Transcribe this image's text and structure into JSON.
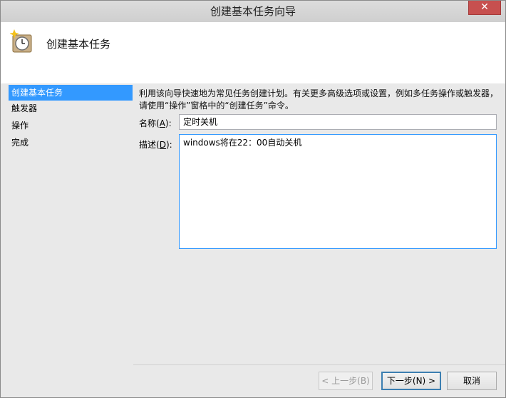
{
  "window": {
    "title": "创建基本任务向导",
    "close_label": "✕"
  },
  "header": {
    "title": "创建基本任务"
  },
  "sidebar": {
    "items": [
      {
        "label": "创建基本任务",
        "active": true
      },
      {
        "label": "触发器",
        "active": false
      },
      {
        "label": "操作",
        "active": false
      },
      {
        "label": "完成",
        "active": false
      }
    ]
  },
  "content": {
    "intro": "利用该向导快速地为常见任务创建计划。有关更多高级选项或设置，例如多任务操作或触发器，请使用“操作”窗格中的“创建任务”命令。",
    "name_label": "名称(",
    "name_key": "A",
    "name_label_end": "):",
    "name_value": "定时关机",
    "desc_label": "描述(",
    "desc_key": "D",
    "desc_label_end": "):",
    "desc_value": "windows将在22：00自动关机"
  },
  "buttons": {
    "back": "< 上一步(B)",
    "next": "下一步(N) >",
    "cancel": "取消"
  }
}
